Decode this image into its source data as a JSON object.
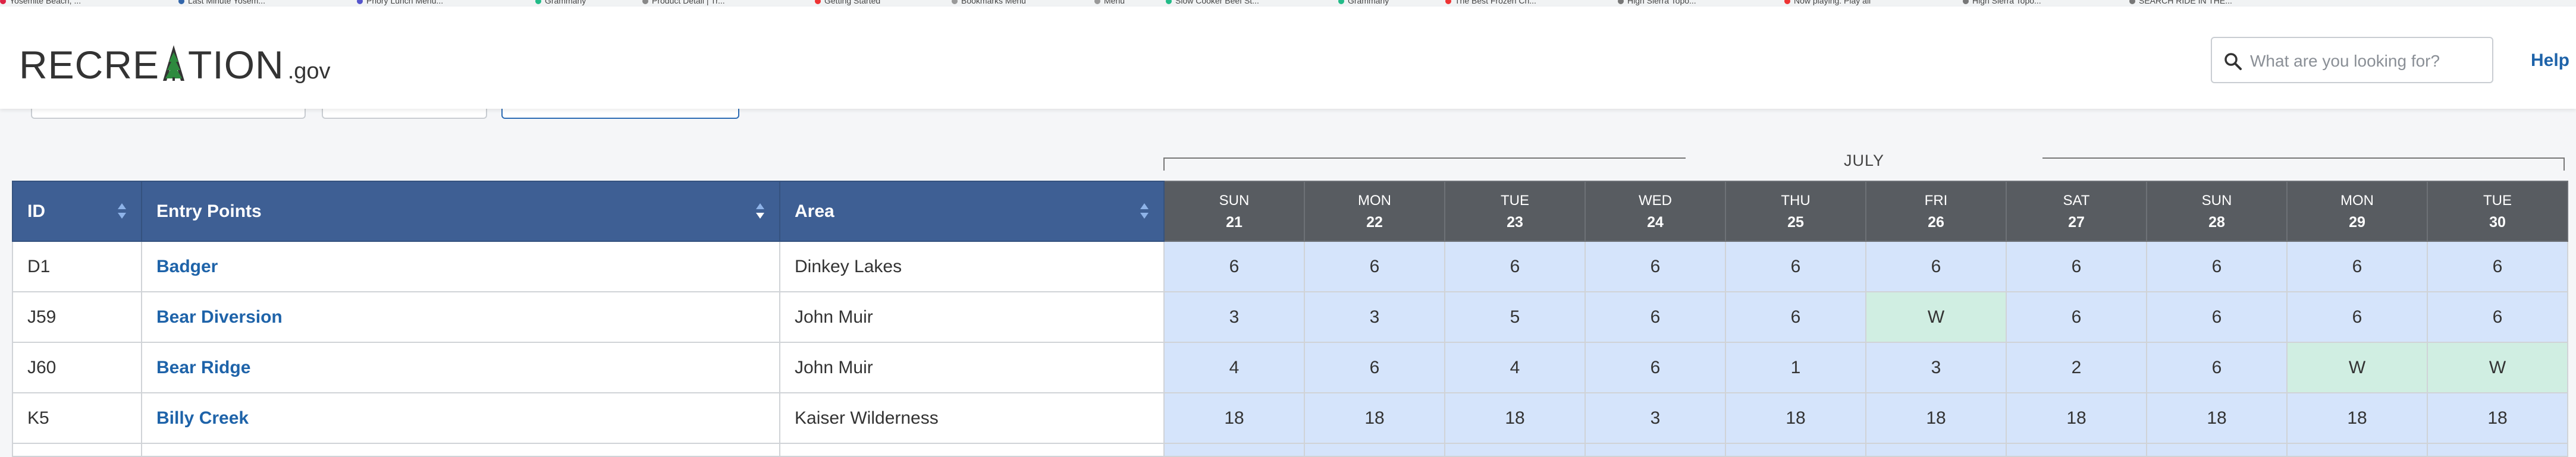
{
  "bookmarks": [
    {
      "label": "Yosemite Beach, ..."
    },
    {
      "label": "Last Minute Yosem..."
    },
    {
      "label": "Priory Lunch Menu..."
    },
    {
      "label": "Grammarly"
    },
    {
      "label": "Product Detail | Tr..."
    },
    {
      "label": "Getting Started"
    },
    {
      "label": "Bookmarks Menu"
    },
    {
      "label": "Menu"
    },
    {
      "label": "Slow Cooker Beef St..."
    },
    {
      "label": "Grammarly"
    },
    {
      "label": "The Best Frozen Ch..."
    },
    {
      "label": "High Sierra Topo..."
    },
    {
      "label": "Now playing: Play all"
    },
    {
      "label": "High Sierra Topo..."
    },
    {
      "label": "SEARCH RIDE IN THE..."
    }
  ],
  "header": {
    "logo_word_left": "RECRE",
    "logo_word_right": "TION",
    "logo_suffix": ".gov",
    "search_placeholder": "What are you looking for?",
    "help_label": "Help"
  },
  "month_label": "JULY",
  "columns": {
    "id": "ID",
    "entry_points": "Entry Points",
    "area": "Area"
  },
  "days": [
    {
      "dow": "SUN",
      "date": "21"
    },
    {
      "dow": "MON",
      "date": "22"
    },
    {
      "dow": "TUE",
      "date": "23"
    },
    {
      "dow": "WED",
      "date": "24"
    },
    {
      "dow": "THU",
      "date": "25"
    },
    {
      "dow": "FRI",
      "date": "26"
    },
    {
      "dow": "SAT",
      "date": "27"
    },
    {
      "dow": "SUN",
      "date": "28"
    },
    {
      "dow": "MON",
      "date": "29"
    },
    {
      "dow": "TUE",
      "date": "30"
    }
  ],
  "rows": [
    {
      "id": "D1",
      "entry_point": "Badger",
      "area": "Dinkey Lakes",
      "cells": [
        "6",
        "6",
        "6",
        "6",
        "6",
        "6",
        "6",
        "6",
        "6",
        "6"
      ]
    },
    {
      "id": "J59",
      "entry_point": "Bear Diversion",
      "area": "John Muir",
      "cells": [
        "3",
        "3",
        "5",
        "6",
        "6",
        "W",
        "6",
        "6",
        "6",
        "6"
      ]
    },
    {
      "id": "J60",
      "entry_point": "Bear Ridge",
      "area": "John Muir",
      "cells": [
        "4",
        "6",
        "4",
        "6",
        "1",
        "3",
        "2",
        "6",
        "W",
        "W"
      ]
    },
    {
      "id": "K5",
      "entry_point": "Billy Creek",
      "area": "Kaiser Wilderness",
      "cells": [
        "18",
        "18",
        "18",
        "3",
        "18",
        "18",
        "18",
        "18",
        "18",
        "18"
      ]
    }
  ],
  "colors": {
    "column_header": "#3e5f94",
    "day_header": "#585c61",
    "available_cell": "#d5e4fb",
    "walkup_cell": "#d0eee2",
    "link": "#1e63a9"
  }
}
